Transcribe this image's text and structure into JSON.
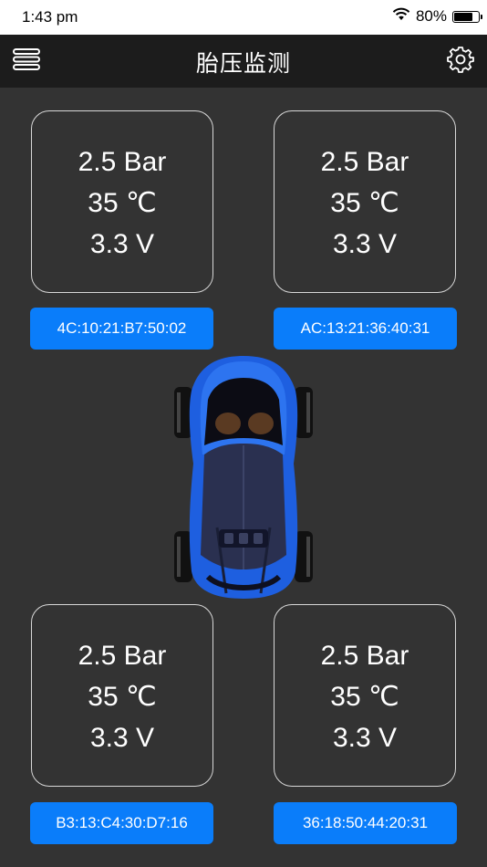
{
  "status_bar": {
    "time": "1:43 pm",
    "battery": "80%",
    "battery_level": 0.8
  },
  "header": {
    "title": "胎压监测",
    "menu_icon": "menu-icon",
    "settings_icon": "gear-icon"
  },
  "tires": [
    {
      "pressure": "2.5 Bar",
      "temperature": "35 ℃",
      "voltage": "3.3 V",
      "mac": "4C:10:21:B7:50:02"
    },
    {
      "pressure": "2.5 Bar",
      "temperature": "35 ℃",
      "voltage": "3.3 V",
      "mac": "AC:13:21:36:40:31"
    },
    {
      "pressure": "2.5 Bar",
      "temperature": "35 ℃",
      "voltage": "3.3 V",
      "mac": "B3:13:C4:30:D7:16"
    },
    {
      "pressure": "2.5 Bar",
      "temperature": "35 ℃",
      "voltage": "3.3 V",
      "mac": "36:18:50:44:20:31"
    }
  ],
  "colors": {
    "background": "#333333",
    "navbar": "#1c1c1c",
    "button": "#0a7dfa",
    "car_body": "#1e5fe0"
  }
}
